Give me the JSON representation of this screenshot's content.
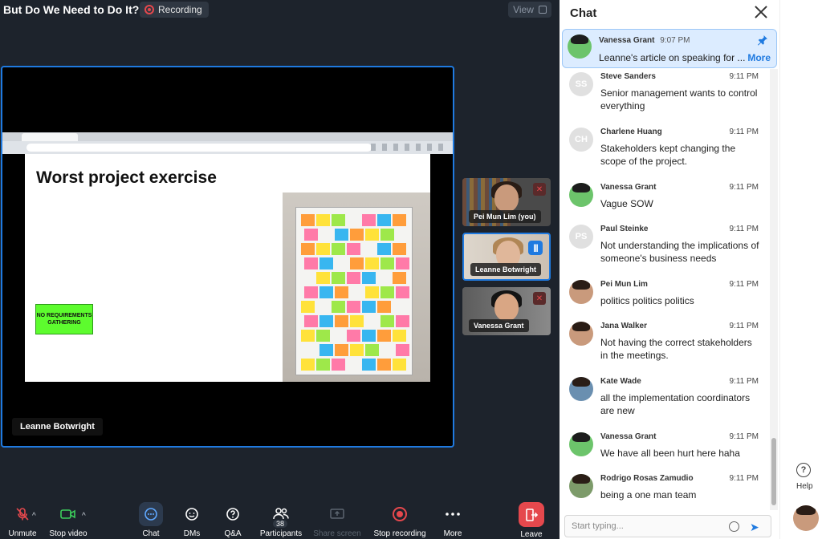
{
  "meeting": {
    "title": "But Do We Need to Do It?",
    "recording_label": "Recording",
    "view_label": "View"
  },
  "slide": {
    "title": "Worst project exercise",
    "note_text": "NO REQUIREMENTS GATHERING"
  },
  "speaker": {
    "name": "Leanne Botwright"
  },
  "thumbnails": [
    {
      "name": "Pei Mun Lim (you)",
      "status": "muted"
    },
    {
      "name": "Leanne Botwright",
      "status": "speaking"
    },
    {
      "name": "Vanessa Grant",
      "status": "muted"
    }
  ],
  "toolbar": {
    "unmute": "Unmute",
    "stop_video": "Stop video",
    "chat": "Chat",
    "dms": "DMs",
    "qa": "Q&A",
    "participants": "Participants",
    "participants_count": "38",
    "share_screen": "Share screen",
    "stop_recording": "Stop recording",
    "more": "More",
    "leave": "Leave"
  },
  "chat": {
    "title": "Chat",
    "pinned": {
      "name": "Vanessa Grant",
      "time": "9:07 PM",
      "text": "Leanne's article on speaking for ...",
      "more": "More"
    },
    "messages": [
      {
        "name": "Steve Sanders",
        "initials": "SS",
        "time": "9:11 PM",
        "text": "Senior management wants to control everything"
      },
      {
        "name": "Charlene Huang",
        "initials": "CH",
        "time": "9:11 PM",
        "text": "Stakeholders kept changing the scope of the project."
      },
      {
        "name": "Vanessa Grant",
        "initials": "",
        "time": "9:11 PM",
        "text": "Vague SOW"
      },
      {
        "name": "Paul Steinke",
        "initials": "PS",
        "time": "9:11 PM",
        "text": "Not understanding the implications of someone's business needs"
      },
      {
        "name": "Pei Mun Lim",
        "initials": "",
        "time": "9:11 PM",
        "text": "politics politics politics"
      },
      {
        "name": "Jana Walker",
        "initials": "",
        "time": "9:11 PM",
        "text": "Not having the correct stakeholders in the meetings."
      },
      {
        "name": "Kate Wade",
        "initials": "",
        "time": "9:11 PM",
        "text": "all the implementation coordinators are new"
      },
      {
        "name": "Vanessa Grant",
        "initials": "",
        "time": "9:11 PM",
        "text": "We have all been hurt here haha"
      },
      {
        "name": "Rodrigo Rosas Zamudio",
        "initials": "",
        "time": "9:11 PM",
        "text": "being a one man team"
      }
    ],
    "input_placeholder": "Start typing..."
  },
  "rail": {
    "help_label": "Help"
  },
  "colors": {
    "accent": "#1f7ae0",
    "danger": "#e5484d",
    "meeting_bg": "#1d232c"
  }
}
